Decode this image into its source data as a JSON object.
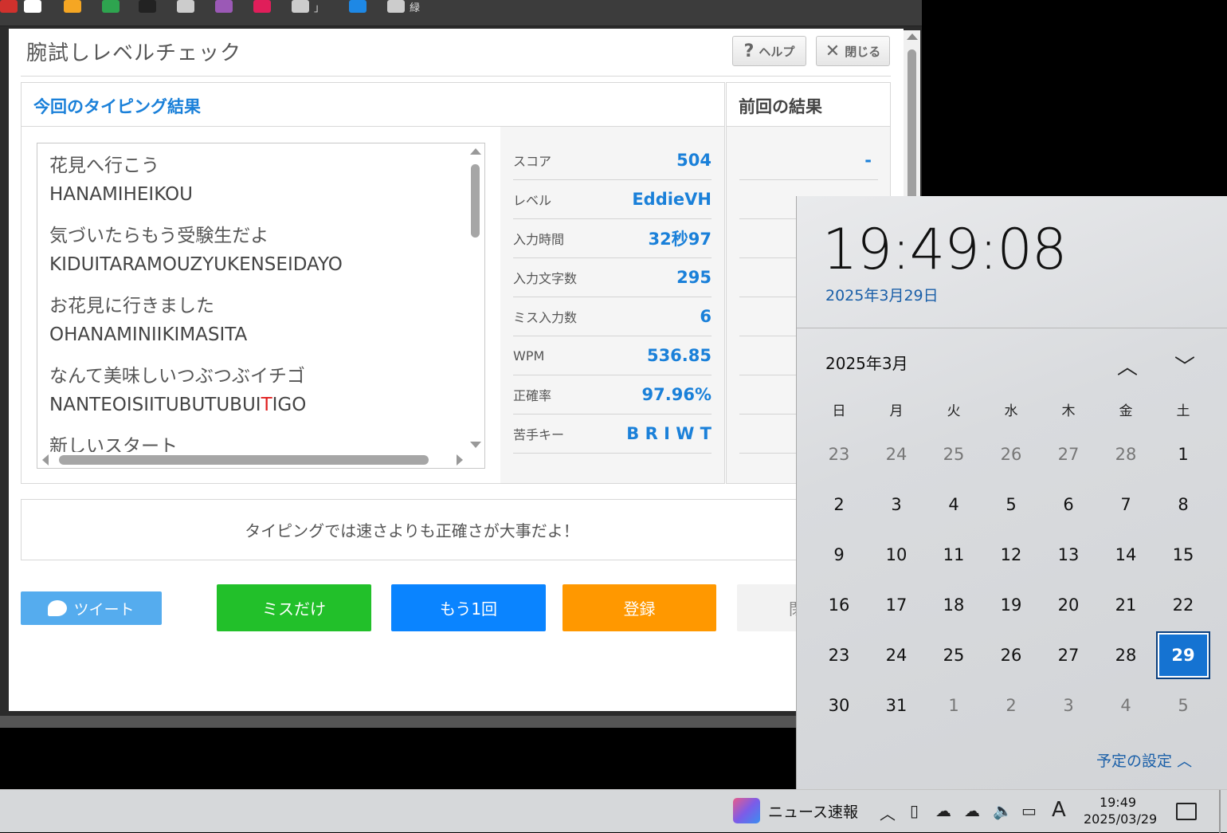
{
  "bookmarks": [
    {
      "icon": "app-icon-red",
      "label": "",
      "color": "#d0312d"
    },
    {
      "icon": "amazon-icon",
      "label": "",
      "color": "#ffffff"
    },
    {
      "icon": "mail-icon",
      "label": "",
      "color": "#f5a623"
    },
    {
      "icon": "clover-icon",
      "label": "",
      "color": "#2ea44f"
    },
    {
      "icon": "openai-icon",
      "label": "",
      "color": "#222222"
    },
    {
      "icon": "wikipedia-icon",
      "label": "",
      "color": "#cccccc"
    },
    {
      "icon": "cube-icon",
      "label": "",
      "color": "#9b59b6"
    },
    {
      "icon": "slack-icon",
      "label": "",
      "color": "#e01e5a"
    },
    {
      "icon": "globe-icon",
      "label": "」",
      "color": "#cccccc"
    },
    {
      "icon": "bookmark-blue-icon",
      "label": "",
      "color": "#1e88e5"
    },
    {
      "icon": "globe-icon",
      "label": "緑",
      "color": "#cccccc"
    }
  ],
  "modal": {
    "title": "腕試しレベルチェック",
    "help_label": "ヘルプ",
    "close_label": "閉じる",
    "current_header": "今回のタイピング結果",
    "previous_header": "前回の結果"
  },
  "texts": [
    {
      "jp": "花見へ行こう",
      "ro_before": "HANAMIHEIKOU",
      "ro_miss": "",
      "ro_after": ""
    },
    {
      "jp": "気づいたらもう受験生だよ",
      "ro_before": "KIDUITARAMOUZYUKENSEIDAYO",
      "ro_miss": "",
      "ro_after": ""
    },
    {
      "jp": "お花見に行きました",
      "ro_before": "OHANAMINIIKIMASITA",
      "ro_miss": "",
      "ro_after": ""
    },
    {
      "jp": "なんて美味しいつぶつぶイチゴ",
      "ro_before": "NANTEOISIITUBUTUBUI",
      "ro_miss": "T",
      "ro_after": "IGO"
    },
    {
      "jp": "新しいスタート",
      "ro_before": "",
      "ro_miss": "",
      "ro_after": ""
    }
  ],
  "stats": [
    {
      "label": "スコア",
      "value": "504",
      "prev": "-"
    },
    {
      "label": "レベル",
      "value": "EddieVH",
      "prev": ""
    },
    {
      "label": "入力時間",
      "value": "32秒97",
      "prev": ""
    },
    {
      "label": "入力文字数",
      "value": "295",
      "prev": ""
    },
    {
      "label": "ミス入力数",
      "value": "6",
      "prev": ""
    },
    {
      "label": "WPM",
      "value": "536.85",
      "prev": ""
    },
    {
      "label": "正確率",
      "value": "97.96%",
      "prev": ""
    },
    {
      "label": "苦手キー",
      "value": "B R I W T",
      "prev": ""
    }
  ],
  "message": "タイピングでは速さよりも正確さが大事だよ！",
  "buttons": {
    "tweet": "ツイート",
    "miss_only": "ミスだけ",
    "retry": "もう1回",
    "register": "登録",
    "close_partial": "閉"
  },
  "colors": {
    "accent_blue": "#1a80d9",
    "tweet": "#55acee",
    "miss_only": "#22c02a",
    "retry": "#0a84ff",
    "register": "#ff9800",
    "miss_char": "#e02020"
  },
  "calendar": {
    "time": "19:49:08",
    "date": "2025年3月29日",
    "month_label": "2025年3月",
    "weekdays": [
      "日",
      "月",
      "火",
      "水",
      "木",
      "金",
      "土"
    ],
    "days": [
      [
        "23",
        "24",
        "25",
        "26",
        "27",
        "28",
        "1"
      ],
      [
        "2",
        "3",
        "4",
        "5",
        "6",
        "7",
        "8"
      ],
      [
        "9",
        "10",
        "11",
        "12",
        "13",
        "14",
        "15"
      ],
      [
        "16",
        "17",
        "18",
        "19",
        "20",
        "21",
        "22"
      ],
      [
        "23",
        "24",
        "25",
        "26",
        "27",
        "28",
        "29"
      ],
      [
        "30",
        "31",
        "1",
        "2",
        "3",
        "4",
        "5"
      ]
    ],
    "selected_day": "29",
    "schedule_label": "予定の設定"
  },
  "taskbar": {
    "news_label": "ニュース速報",
    "ime_label": "A",
    "time": "19:49",
    "date": "2025/03/29"
  }
}
